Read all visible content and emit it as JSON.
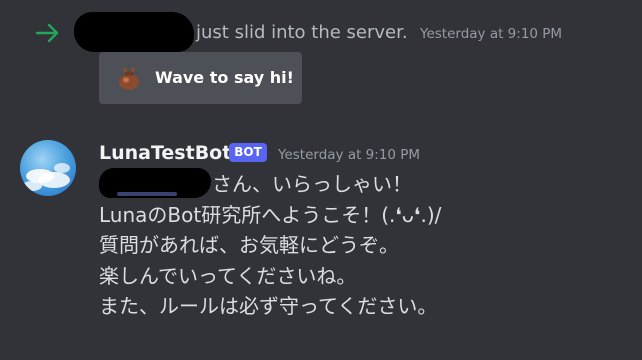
{
  "system_message": {
    "join_text": "just slid into the server.",
    "timestamp": "Yesterday at 9:10 PM",
    "arrow_color": "#23a55a"
  },
  "wave_button": {
    "label": "Wave to say hi!",
    "icon": "waving-bag-icon"
  },
  "message": {
    "author": "LunaTestBot",
    "badge": "BOT",
    "timestamp": "Yesterday at 9:10 PM",
    "badge_color": "#5865f2",
    "lines": [
      "さん、いらっしゃい！",
      "LunaのBot研究所へようこそ！(.❛ᴗ❛.)/",
      "質問があれば、お気軽にどうぞ。",
      "楽しんでいってくださいね。",
      "また、ルールは必ず守ってください。"
    ]
  }
}
